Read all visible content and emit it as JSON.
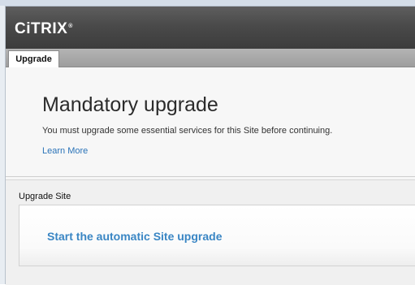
{
  "header": {
    "brand": "CiTRIX",
    "brand_mark": "®"
  },
  "tabs": [
    {
      "label": "Upgrade"
    }
  ],
  "main": {
    "title": "Mandatory upgrade",
    "description": "You must upgrade some essential services for this Site before continuing.",
    "learn_more": "Learn More"
  },
  "upgrade_section": {
    "label": "Upgrade Site",
    "action": "Start the automatic Site upgrade"
  }
}
